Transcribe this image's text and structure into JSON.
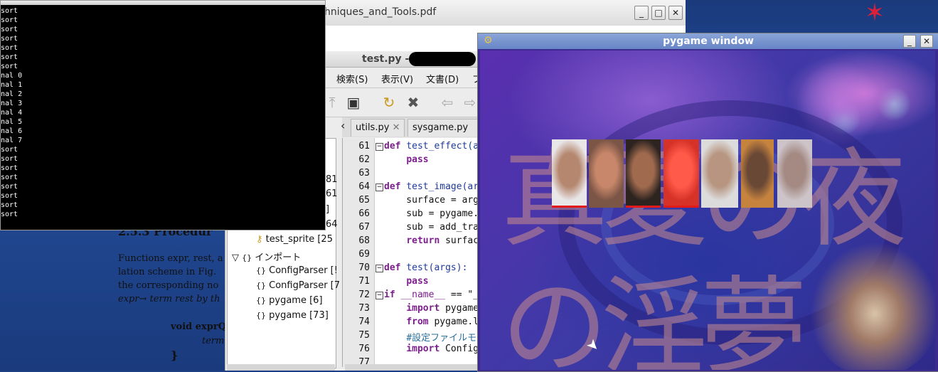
{
  "pdf": {
    "title": "hniques_and_Tools.pdf",
    "section_heading": "2.5.3   Procedur",
    "paragraph": [
      "Functions expr, rest, a",
      "lation scheme in Fig.",
      "the corresponding no",
      "expr→ term rest by th"
    ],
    "code": [
      "void exprQ",
      "term",
      "}"
    ]
  },
  "editor": {
    "title": "test.py -",
    "menus": [
      "検索(S)",
      "表示(V)",
      "文書(D)",
      "フ"
    ],
    "tabs": [
      {
        "label": "utils.py"
      },
      {
        "label": "sysgame.py"
      }
    ],
    "tree": [
      {
        "label": "test_sprite [25"
      },
      {
        "label": "インポート"
      },
      {
        "label": "ConfigParser [!"
      },
      {
        "label": "ConfigParser [7"
      },
      {
        "label": "pygame [6]"
      },
      {
        "label": "pygame [73]"
      }
    ],
    "tree_right_nums": [
      "81",
      "61",
      "]",
      "64"
    ],
    "line_numbers": [
      "61",
      "62",
      "63",
      "64",
      "65",
      "66",
      "67",
      "68",
      "69",
      "70",
      "71",
      "72",
      "73",
      "74",
      "75",
      "76",
      "77"
    ]
  },
  "terminal": {
    "lines": [
      "sort",
      "sort",
      "sort",
      "sort",
      "sort",
      "sort",
      "sort",
      "nal 0",
      "nal 1",
      "nal 2",
      "nal 3",
      "nal 4",
      "nal 5",
      "nal 6",
      "nal 7",
      "sort",
      "sort",
      "sort",
      "sort",
      "sort",
      "sort",
      "sort",
      "sort"
    ]
  },
  "pygame": {
    "title": "pygame window",
    "faces": [
      {
        "colors": [
          "#e9e6e8",
          "#b5876f"
        ],
        "bar": true
      },
      {
        "colors": [
          "#7b5546",
          "#c8876a"
        ],
        "bar": false
      },
      {
        "colors": [
          "#2d2420",
          "#a06a4e"
        ],
        "bar": true
      },
      {
        "colors": [
          "#d73227",
          "#ff5a4a"
        ],
        "bar": true
      },
      {
        "colors": [
          "#dcdcdc",
          "#b79580"
        ],
        "bar": false
      },
      {
        "colors": [
          "#c5833e",
          "#6a4836"
        ],
        "bar": false
      },
      {
        "colors": [
          "#ccc4c8",
          "#a58a84"
        ],
        "bar": false
      }
    ],
    "deco_text": "真夏の夜の淫夢"
  }
}
